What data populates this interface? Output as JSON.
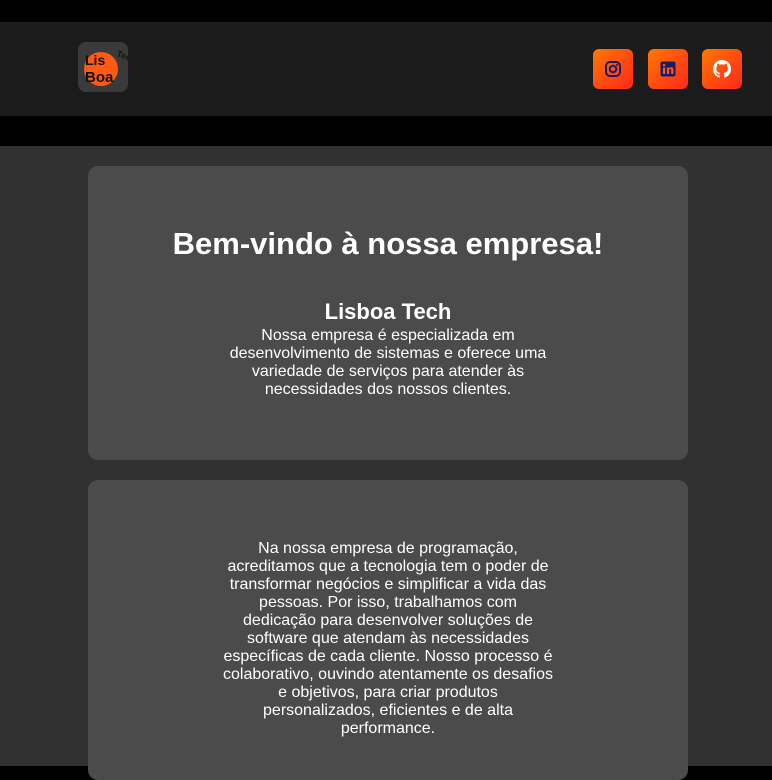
{
  "brand": {
    "logo_text_top": "Lis",
    "logo_text_bottom": "Boa",
    "logo_text_side": "Tech",
    "accent": "#ff5a14"
  },
  "social": [
    {
      "name": "instagram",
      "icon": "instagram-icon"
    },
    {
      "name": "linkedin",
      "icon": "linkedin-icon"
    },
    {
      "name": "github",
      "icon": "github-icon"
    }
  ],
  "hero": {
    "title": "Bem-vindo à nossa empresa!",
    "subtitle": "Lisboa Tech",
    "text": "Nossa empresa é especializada em desenvolvimento de sistemas e oferece uma variedade de serviços para atender às necessidades dos nossos clientes."
  },
  "about": {
    "text": "Na nossa empresa de programação, acreditamos que a tecnologia tem o poder de transformar negócios e simplificar a vida das pessoas. Por isso, trabalhamos com dedicação para desenvolver soluções de software que atendam às necessidades específicas de cada cliente. Nosso processo é colaborativo, ouvindo atentamente os desafios e objetivos, para criar produtos personalizados, eficientes e de alta performance."
  }
}
